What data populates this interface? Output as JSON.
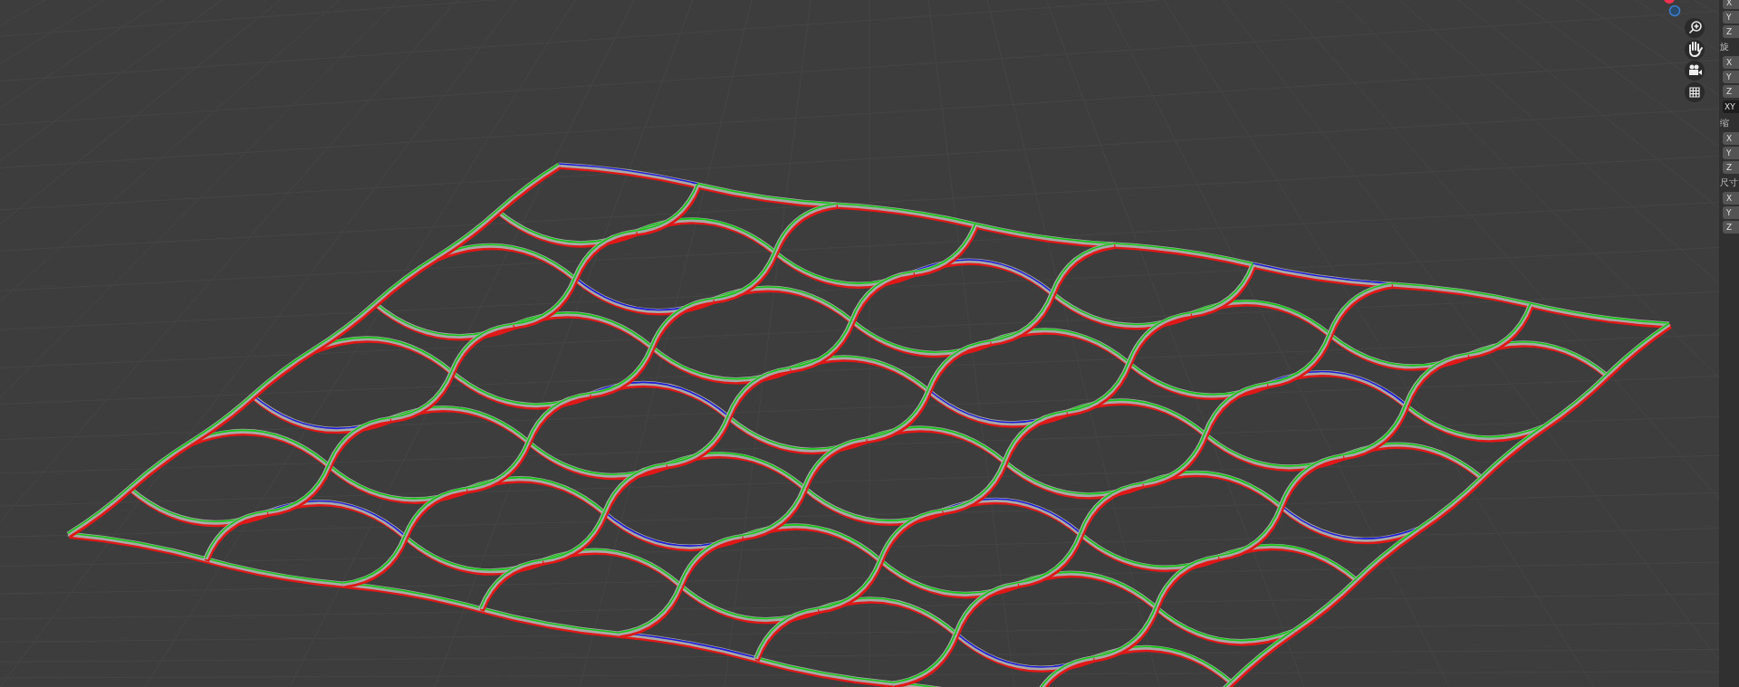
{
  "sidebar": {
    "rows": [
      {
        "kind": "field",
        "label": "X"
      },
      {
        "kind": "field",
        "label": "Y"
      },
      {
        "kind": "field",
        "label": "Z"
      },
      {
        "kind": "heading",
        "label": "旋"
      },
      {
        "kind": "field",
        "label": "X"
      },
      {
        "kind": "field",
        "label": "Y"
      },
      {
        "kind": "field",
        "label": "Z"
      },
      {
        "kind": "dropdown",
        "label": "XY"
      },
      {
        "kind": "heading",
        "label": "缩"
      },
      {
        "kind": "field",
        "label": "X"
      },
      {
        "kind": "field",
        "label": "Y"
      },
      {
        "kind": "field",
        "label": "Z"
      },
      {
        "kind": "heading",
        "label": "尺寸"
      },
      {
        "kind": "field",
        "label": "X"
      },
      {
        "kind": "field",
        "label": "Y"
      },
      {
        "kind": "field",
        "label": "Z"
      }
    ]
  }
}
